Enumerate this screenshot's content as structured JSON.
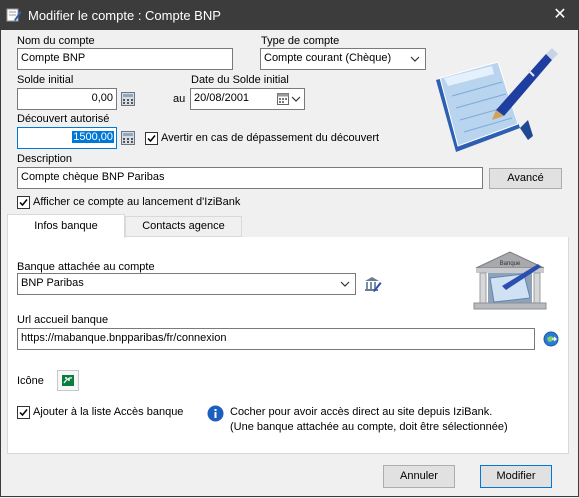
{
  "window": {
    "title": "Modifier le compte : Compte BNP",
    "close_glyph": "✕"
  },
  "form": {
    "account_name_label": "Nom du compte",
    "account_name_value": "Compte BNP",
    "account_type_label": "Type de compte",
    "account_type_value": "Compte courant (Chèque)",
    "initial_balance_label": "Solde initial",
    "initial_balance_value": "0,00",
    "au_label": "au",
    "balance_date_label": "Date du Solde initial",
    "balance_date_value": "20/08/2001",
    "overdraft_label": "Découvert autorisé",
    "overdraft_value": "1500,00",
    "overdraft_warn_label": "Avertir en cas de dépassement du découvert",
    "overdraft_warn_checked": true,
    "description_label": "Description",
    "description_value": "Compte chèque BNP Paribas",
    "advanced_button": "Avancé",
    "show_on_launch_label": "Afficher ce compte au lancement d'IziBank",
    "show_on_launch_checked": true
  },
  "tabs": [
    {
      "label": "Infos banque",
      "active": true
    },
    {
      "label": "Contacts agence",
      "active": false
    }
  ],
  "bank_tab": {
    "bank_label": "Banque attachée au compte",
    "bank_value": "BNP Paribas",
    "bank_illustration_text": "Banque",
    "url_label": "Url accueil banque",
    "url_value": "https://mabanque.bnpparibas/fr/connexion",
    "icon_label": "Icône",
    "add_access_label": "Ajouter à la liste Accès banque",
    "add_access_checked": true,
    "info_text_line1": "Cocher pour avoir accès direct au site depuis IziBank.",
    "info_text_line2": "(Une banque attachée au compte, doit être sélectionnée)"
  },
  "footer": {
    "cancel_button": "Annuler",
    "modify_button": "Modifier"
  },
  "icons": {
    "app": "edit-account-icon",
    "calendar": "calculator-icon",
    "date_picker": "calendar-icon",
    "bank_edit": "bank-edit-icon",
    "globe": "globe-icon",
    "info": "info-icon",
    "bank_icon": "bank-logo-icon"
  },
  "colors": {
    "titlebar": "#3c3c3c",
    "accent": "#0078d7",
    "panel": "#ffffff",
    "background": "#f0f0f0"
  }
}
